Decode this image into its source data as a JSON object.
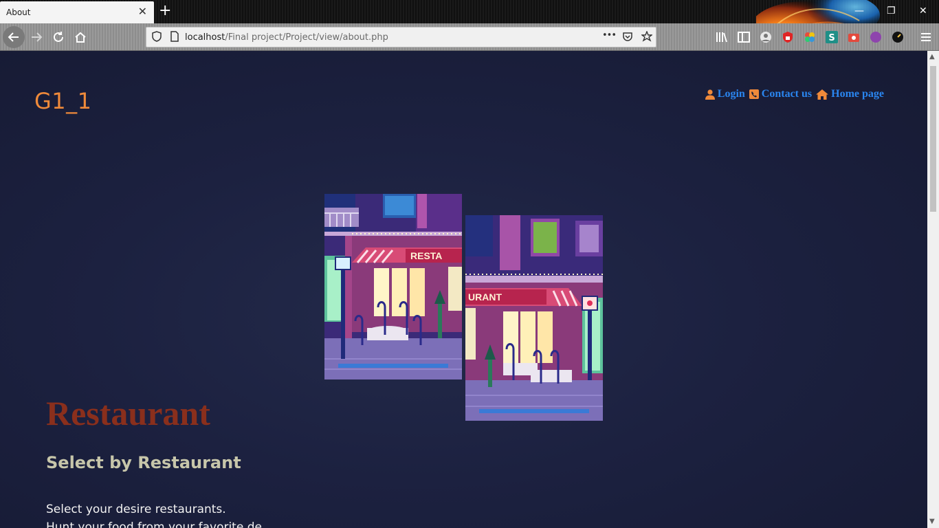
{
  "browser": {
    "tab_title": "About",
    "tab_close": "✕",
    "new_tab": "+",
    "url_host": "localhost",
    "url_path": "/Final project/Project/view/about.php",
    "url_more": "•••",
    "window_minimize": "—",
    "window_restore": "❐",
    "window_close": "✕"
  },
  "site": {
    "logo": "G1_1",
    "nav": [
      {
        "label": "Login",
        "icon": "user-icon"
      },
      {
        "label": "Contact us",
        "icon": "phone-icon"
      },
      {
        "label": "Home page",
        "icon": "home-icon"
      }
    ]
  },
  "content": {
    "title": "Restaurant",
    "subtitle": "Select by Restaurant",
    "paragraph_1": "Select your desire restaurants.",
    "paragraph_2": "Hunt your food from your favorite de"
  },
  "colors": {
    "page_background": "#1b2038",
    "logo": "#ef8a3a",
    "nav_link": "#2a86f0",
    "title": "#8a2f1c",
    "subtitle": "#c7c6aa"
  }
}
